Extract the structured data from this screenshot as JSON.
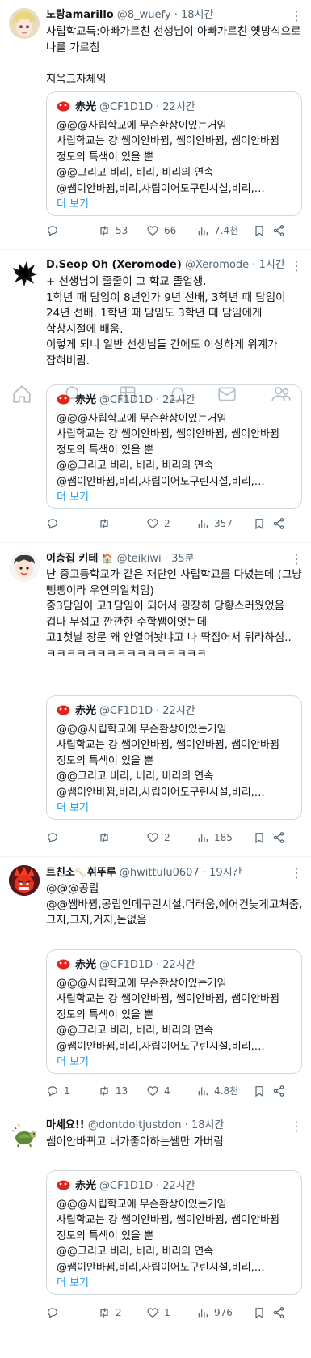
{
  "quoted": {
    "name": "赤光",
    "handle": "@CF1D1D",
    "time": "22시간",
    "text": "@@@사립학교에 무슨환상이있는거임\n사립학교는 걍 쌤이안바뀜, 쌤이안바뀜, 쌤이안바뀜 정도의 특색이 있을 뿐\n@@그리고 비리, 비리, 비리의 연속\n@쌤이안바뀜,비리,사립이어도구린시설,비리,…",
    "more": "더 보기"
  },
  "tweets": [
    {
      "name": "노랑amarillo",
      "handle": "@8_wuefy",
      "time": "18시간",
      "text": "사립학교특:아빠가르친 선생님이 아빠가르친 옛방식으로 나를 가르침\n\n지옥그자체임",
      "actions": {
        "reply": "",
        "retweet": "53",
        "like": "66",
        "views": "7.4천"
      }
    },
    {
      "name": "D.Seop Oh (Xeromode)",
      "handle": "@Xeromode",
      "time": "1시간",
      "text": "+ 선생님이 줄줄이 그 학교 졸업생.\n1학년 때 담임이 8년인가 9년 선배, 3학년 때 담임이 24년 선배. 1학년 때 담임도 3학년 때 담임에게 학창시절에 배움.\n이렇게 되니 일반 선생님들 간에도 이상하게 위계가 잡혀버림.",
      "actions": {
        "reply": "",
        "retweet": "",
        "like": "2",
        "views": "357"
      }
    },
    {
      "name": "이층집 키테",
      "emoji": "🏠",
      "handle": "@teikiwi",
      "time": "35분",
      "text": "난 중고등학교가 같은 재단인 사립학교를 다녔는데 (그냥 뺑뺑이라 우연의일치임)\n중3담임이 고1담임이 되어서 굉장히 당황스러웠었음\n겁나 무섭고 깐깐한 수학쌤이엇는데\n고1첫날 창문 왜 안열어놧냐고 나 딱집어서 뭐라하심..\nㅋㅋㅋㅋㅋㅋㅋㅋㅋㅋㅋㅋㅋㅋㅋㅋ",
      "actions": {
        "reply": "",
        "retweet": "",
        "like": "2",
        "views": "185"
      }
    },
    {
      "name": "트친소",
      "emoji": "🦴",
      "name2": "휘뚜루",
      "handle": "@hwittulu0607",
      "time": "19시간",
      "text": "@@@공립\n@@쌤바뀜,공립인데구린시설,더러움,에어컨늦게고쳐줌,그지,그지,거지,돈없음",
      "actions": {
        "reply": "1",
        "retweet": "13",
        "like": "4",
        "views": "4.8천"
      }
    },
    {
      "name": "마세요!!",
      "handle": "@dontdoitjustdon",
      "time": "18시간",
      "text": "쌤이안바뀌고 내가좋아하는쌤만 가버림",
      "actions": {
        "reply": "",
        "retweet": "2",
        "like": "1",
        "views": "976"
      }
    }
  ],
  "navbar": [
    "home-icon",
    "search-icon",
    "communities-icon",
    "notifications-icon",
    "messages-icon",
    "people-icon"
  ],
  "colors": {
    "accent": "#1d9bf0",
    "muted": "#536471",
    "border": "#cfd9de",
    "divider": "#eff3f4"
  }
}
